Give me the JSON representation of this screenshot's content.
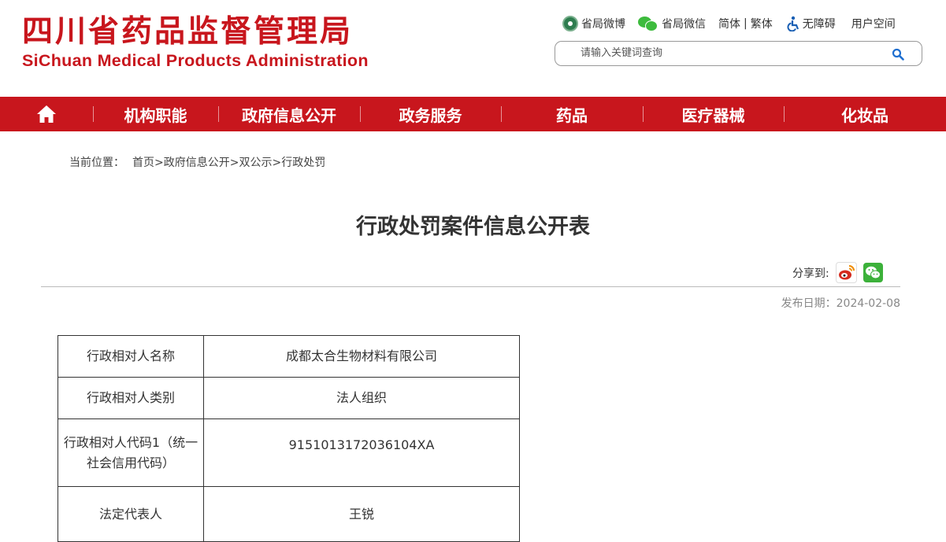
{
  "header": {
    "logo_cn": "四川省药品监督管理局",
    "logo_en": "SiChuan Medical Products Administration",
    "links": {
      "weibo": "省局微博",
      "wechat": "省局微信",
      "simplified": "简体",
      "divider": "|",
      "traditional": "繁体",
      "accessible": "无障碍",
      "user_space": "用户空间"
    },
    "search": {
      "placeholder": "请输入关键词查询"
    }
  },
  "nav": {
    "home_icon": "home-icon",
    "items": [
      "机构职能",
      "政府信息公开",
      "政务服务",
      "药品",
      "医疗器械",
      "化妆品"
    ]
  },
  "breadcrumb": {
    "prefix": "当前位置：",
    "items": [
      "首页",
      "政府信息公开",
      "双公示",
      "行政处罚"
    ],
    "sep": ">"
  },
  "article": {
    "title": "行政处罚案件信息公开表",
    "share_label": "分享到:",
    "share_icons": [
      "weibo-share-icon",
      "wechat-share-icon"
    ],
    "pub_date": "发布日期：2024-02-08"
  },
  "table": {
    "rows": [
      {
        "label": "行政相对人名称",
        "value": "成都太合生物材料有限公司"
      },
      {
        "label": "行政相对人类别",
        "value": "法人组织"
      },
      {
        "label": "行政相对人代码1（统一社会信用代码）",
        "value": "915101317203610​4XA"
      },
      {
        "label": "法定代表人",
        "value": "王锐"
      }
    ]
  },
  "colors": {
    "brand_red": "#c8161d"
  }
}
